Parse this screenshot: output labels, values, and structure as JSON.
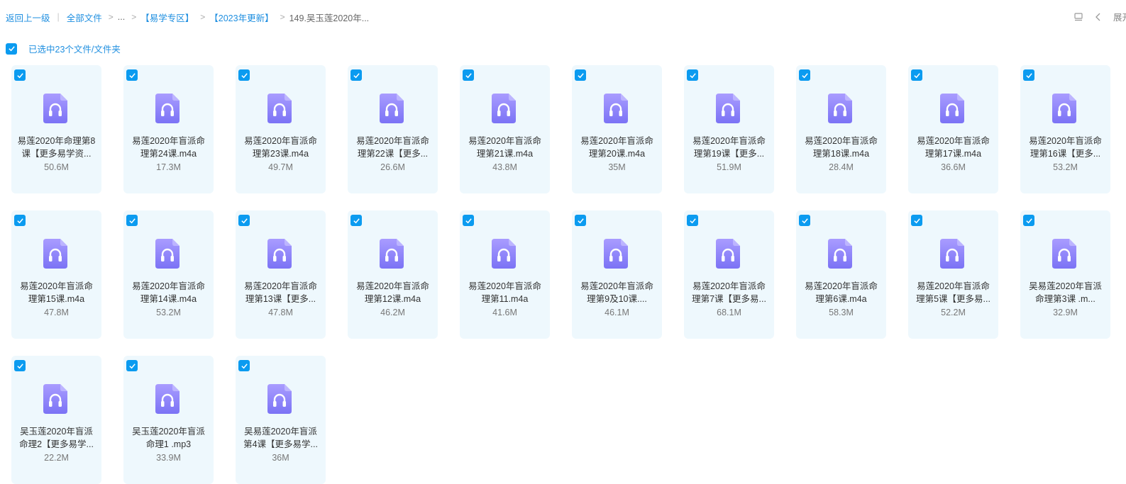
{
  "breadcrumb": {
    "back": "返回上一级",
    "all_files": "全部文件",
    "ellipsis": "...",
    "folder1": "【易学专区】",
    "folder2": "【2023年更新】",
    "current": "149.吴玉莲2020年..."
  },
  "toolbar": {
    "expand_label": "展开"
  },
  "selection": {
    "label": "已选中23个文件/文件夹"
  },
  "colors": {
    "accent": "#1f8fe0",
    "checkbox": "#0b9bf0",
    "card_bg": "#eef8fd",
    "icon_top": "#a99cff",
    "icon_bottom": "#7b73f5"
  },
  "files": [
    {
      "name": "易莲2020年命理第8课【更多易学资...",
      "size": "50.6M",
      "icon": "audio-file-icon",
      "checked": true
    },
    {
      "name": "易莲2020年盲派命理第24课.m4a",
      "size": "17.3M",
      "icon": "audio-file-icon",
      "checked": true
    },
    {
      "name": "易莲2020年盲派命理第23课.m4a",
      "size": "49.7M",
      "icon": "audio-file-icon",
      "checked": true
    },
    {
      "name": "易莲2020年盲派命理第22课【更多...",
      "size": "26.6M",
      "icon": "audio-file-icon",
      "checked": true
    },
    {
      "name": "易莲2020年盲派命理第21课.m4a",
      "size": "43.8M",
      "icon": "audio-file-icon",
      "checked": true
    },
    {
      "name": "易莲2020年盲派命理第20课.m4a",
      "size": "35M",
      "icon": "audio-file-icon",
      "checked": true
    },
    {
      "name": "易莲2020年盲派命理第19课【更多...",
      "size": "51.9M",
      "icon": "audio-file-icon",
      "checked": true
    },
    {
      "name": "易莲2020年盲派命理第18课.m4a",
      "size": "28.4M",
      "icon": "audio-file-icon",
      "checked": true
    },
    {
      "name": "易莲2020年盲派命理第17课.m4a",
      "size": "36.6M",
      "icon": "audio-file-icon",
      "checked": true
    },
    {
      "name": "易莲2020年盲派命理第16课【更多...",
      "size": "53.2M",
      "icon": "audio-file-icon",
      "checked": true
    },
    {
      "name": "易莲2020年盲派命理第15课.m4a",
      "size": "47.8M",
      "icon": "audio-file-icon",
      "checked": true
    },
    {
      "name": "易莲2020年盲派命理第14课.m4a",
      "size": "53.2M",
      "icon": "audio-file-icon",
      "checked": true
    },
    {
      "name": "易莲2020年盲派命理第13课【更多...",
      "size": "47.8M",
      "icon": "audio-file-icon",
      "checked": true
    },
    {
      "name": "易莲2020年盲派命理第12课.m4a",
      "size": "46.2M",
      "icon": "audio-file-icon",
      "checked": true
    },
    {
      "name": "易莲2020年盲派命理第11.m4a",
      "size": "41.6M",
      "icon": "audio-file-icon",
      "checked": true
    },
    {
      "name": "易莲2020年盲派命理第9及10课....",
      "size": "46.1M",
      "icon": "audio-file-icon",
      "checked": true
    },
    {
      "name": "易莲2020年盲派命理第7课【更多易...",
      "size": "68.1M",
      "icon": "audio-file-icon",
      "checked": true
    },
    {
      "name": "易莲2020年盲派命理第6课.m4a",
      "size": "58.3M",
      "icon": "audio-file-icon",
      "checked": true
    },
    {
      "name": "易莲2020年盲派命理第5课【更多易...",
      "size": "52.2M",
      "icon": "audio-file-icon",
      "checked": true
    },
    {
      "name": "吴易莲2020年盲派命理第3课 .m...",
      "size": "32.9M",
      "icon": "audio-file-icon",
      "checked": true
    },
    {
      "name": "吴玉莲2020年盲派命理2【更多易学...",
      "size": "22.2M",
      "icon": "audio-file-icon",
      "checked": true
    },
    {
      "name": "吴玉莲2020年盲派命理1 .mp3",
      "size": "33.9M",
      "icon": "audio-file-icon",
      "checked": true
    },
    {
      "name": "吴易莲2020年盲派第4课【更多易学...",
      "size": "36M",
      "icon": "audio-file-icon",
      "checked": true
    }
  ]
}
